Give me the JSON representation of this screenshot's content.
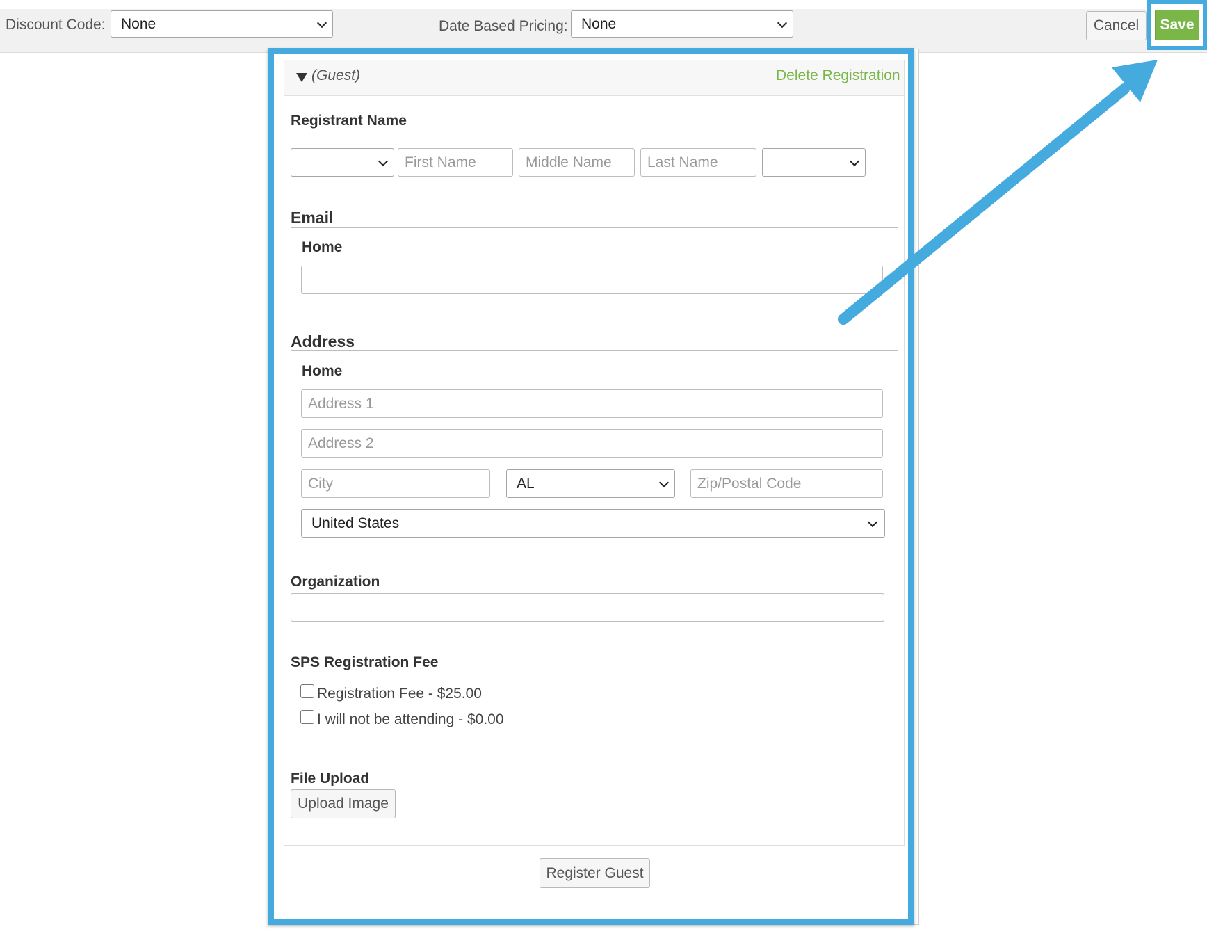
{
  "toolbar": {
    "discount_label": "Discount Code:",
    "discount_value": "None",
    "date_pricing_label": "Date Based Pricing:",
    "date_pricing_value": "None",
    "cancel_label": "Cancel",
    "save_label": "Save"
  },
  "registration": {
    "guest_label": "(Guest)",
    "delete_label": "Delete Registration",
    "name_section": "Registrant Name",
    "prefix_value": "",
    "first_name_placeholder": "First Name",
    "middle_name_placeholder": "Middle Name",
    "last_name_placeholder": "Last Name",
    "suffix_value": "",
    "email_section": "Email",
    "email_home_label": "Home",
    "email_value": "",
    "address_section": "Address",
    "address_home_label": "Home",
    "address1_placeholder": "Address 1",
    "address2_placeholder": "Address 2",
    "city_placeholder": "City",
    "state_value": "AL",
    "zip_placeholder": "Zip/Postal Code",
    "country_value": "United States",
    "organization_label": "Organization",
    "organization_value": "",
    "fee_section": "SPS Registration Fee",
    "fee_options": [
      {
        "label": "Registration Fee - $25.00",
        "checked": false
      },
      {
        "label": "I will not be attending - $0.00",
        "checked": false
      }
    ],
    "file_upload_label": "File Upload",
    "upload_button_label": "Upload Image",
    "register_button_label": "Register Guest"
  },
  "colors": {
    "highlight": "#45abdf",
    "save_button": "#7ab648",
    "delete_link": "#7ab648"
  }
}
